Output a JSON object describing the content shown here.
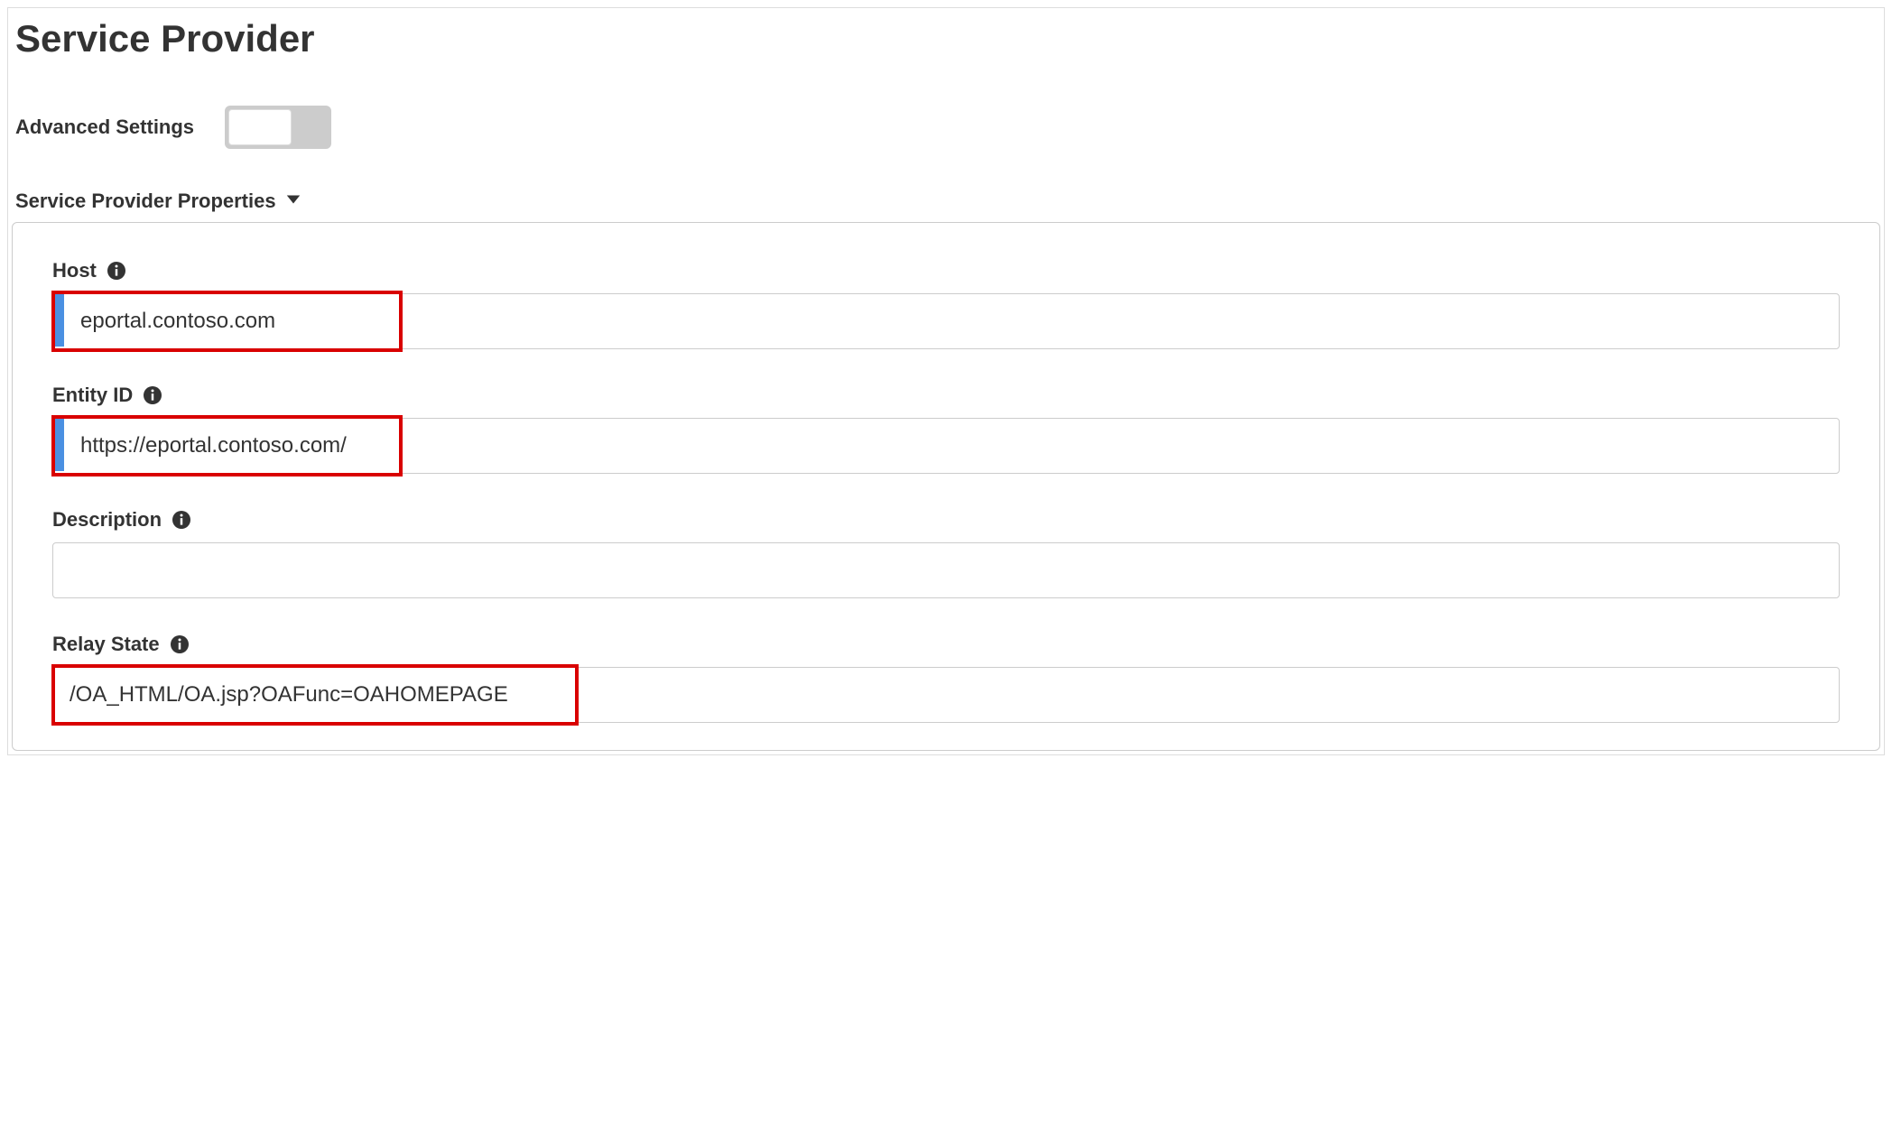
{
  "page": {
    "title": "Service Provider"
  },
  "advanced": {
    "label": "Advanced Settings",
    "enabled": false
  },
  "section": {
    "title": "Service Provider Properties"
  },
  "fields": {
    "host": {
      "label": "Host",
      "value": "eportal.contoso.com"
    },
    "entity_id": {
      "label": "Entity ID",
      "value": "https://eportal.contoso.com/"
    },
    "description": {
      "label": "Description",
      "value": ""
    },
    "relay_state": {
      "label": "Relay State",
      "value": "/OA_HTML/OA.jsp?OAFunc=OAHOMEPAGE"
    }
  }
}
